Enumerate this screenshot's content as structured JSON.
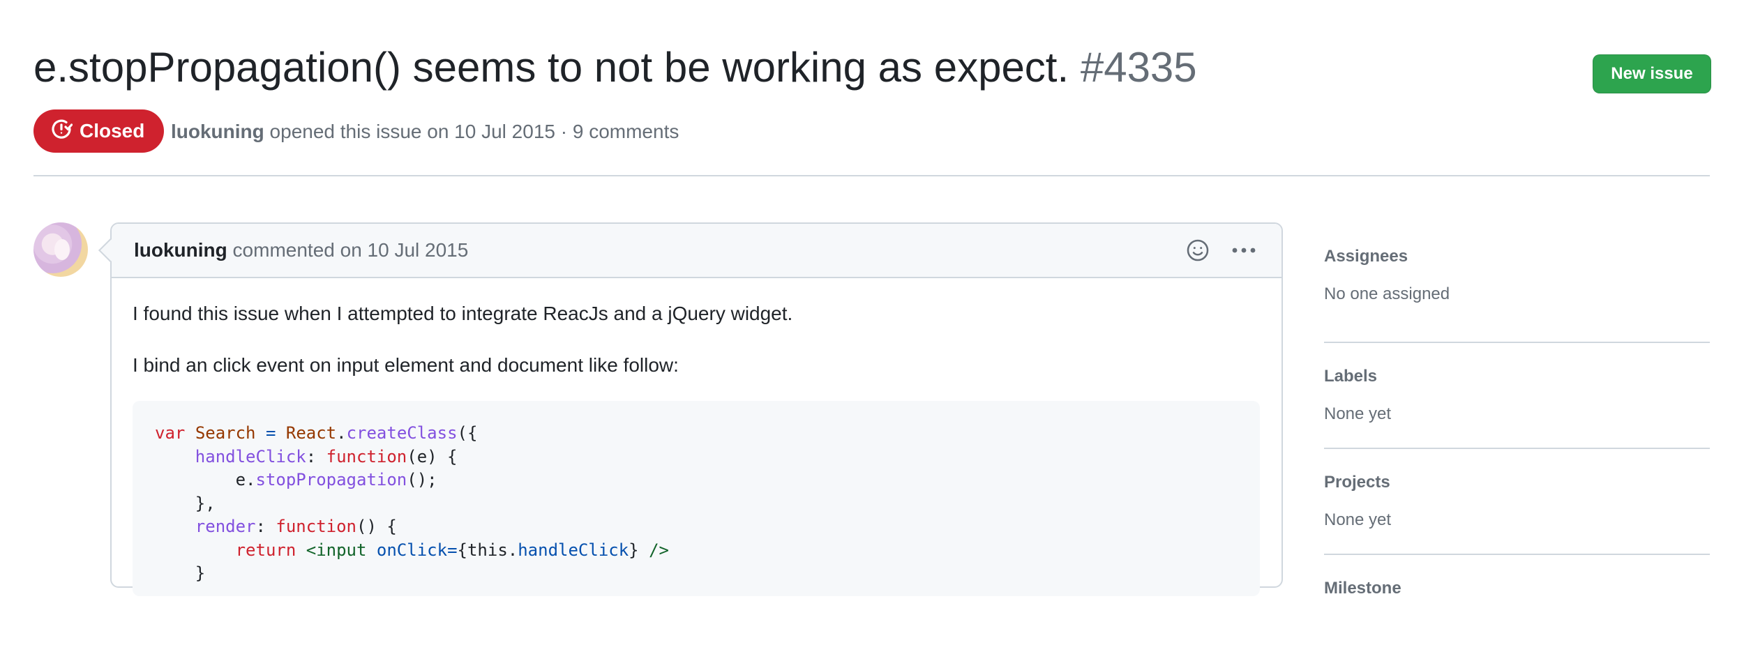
{
  "issue": {
    "title": "e.stopPropagation() seems to not be working as expect.",
    "number": "#4335",
    "new_issue_label": "New issue",
    "status": "Closed",
    "author": "luokuning",
    "meta_text": "opened this issue on 10 Jul 2015 · 9 comments"
  },
  "comment": {
    "author": "luokuning",
    "meta": "commented on 10 Jul 2015",
    "paragraph1": "I found this issue when I attempted to integrate ReacJs and a jQuery widget.",
    "paragraph2": "I bind an click event on input element and document like follow:",
    "code_lines": [
      "var Search = React.createClass({",
      "    handleClick: function(e) {",
      "        e.stopPropagation();",
      "    },",
      "    render: function() {",
      "        return <input onClick={this.handleClick} />",
      "    }"
    ]
  },
  "sidebar": {
    "sections": [
      {
        "title": "Assignees",
        "value": "No one assigned"
      },
      {
        "title": "Labels",
        "value": "None yet"
      },
      {
        "title": "Projects",
        "value": "None yet"
      },
      {
        "title": "Milestone",
        "value": ""
      }
    ]
  },
  "icons": {
    "status": "issue-closed-icon",
    "reaction": "smiley-icon",
    "more": "kebab-horizontal-icon"
  },
  "colors": {
    "closed": "#cf222e",
    "new_issue": "#2da44e"
  }
}
